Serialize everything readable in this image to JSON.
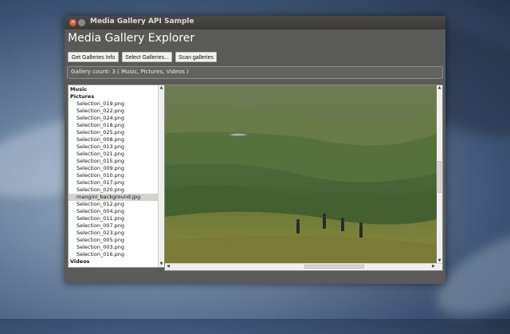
{
  "window": {
    "title": "Media Gallery API Sample"
  },
  "app": {
    "heading": "Media Gallery Explorer"
  },
  "toolbar": {
    "get_info_label": "Get Galleries Info",
    "select_label": "Select Galleries...",
    "scan_label": "Scan galleries"
  },
  "status": {
    "gallery_count": "Gallery count: 3 ( Music, Pictures, Videos )"
  },
  "tree": {
    "music": "Music",
    "pictures": "Pictures",
    "videos": "Videos",
    "files": [
      "Selection_019.png",
      "Selection_022.png",
      "Selection_024.png",
      "Selection_018.png",
      "Selection_025.png",
      "Selection_008.png",
      "Selection_013.png",
      "Selection_021.png",
      "Selection_015.png",
      "Selection_009.png",
      "Selection_010.png",
      "Selection_017.png",
      "Selection_020.png",
      "mangini_background.jpg",
      "Selection_012.png",
      "Selection_004.png",
      "Selection_011.png",
      "Selection_007.png",
      "Selection_023.png",
      "Selection_005.png",
      "Selection_003.png",
      "Selection_016.png"
    ],
    "selected_file": "mangini_background.jpg"
  },
  "icons": {
    "close": "close-icon",
    "minimize": "minimize-icon",
    "scroll_up": "arrow-up-icon",
    "scroll_down": "arrow-down-icon",
    "scroll_left": "arrow-left-icon",
    "scroll_right": "arrow-right-icon"
  },
  "colors": {
    "window_bg": "#5a5a58",
    "close_button": "#e4572e",
    "selected_row": "#d2d2d0"
  }
}
